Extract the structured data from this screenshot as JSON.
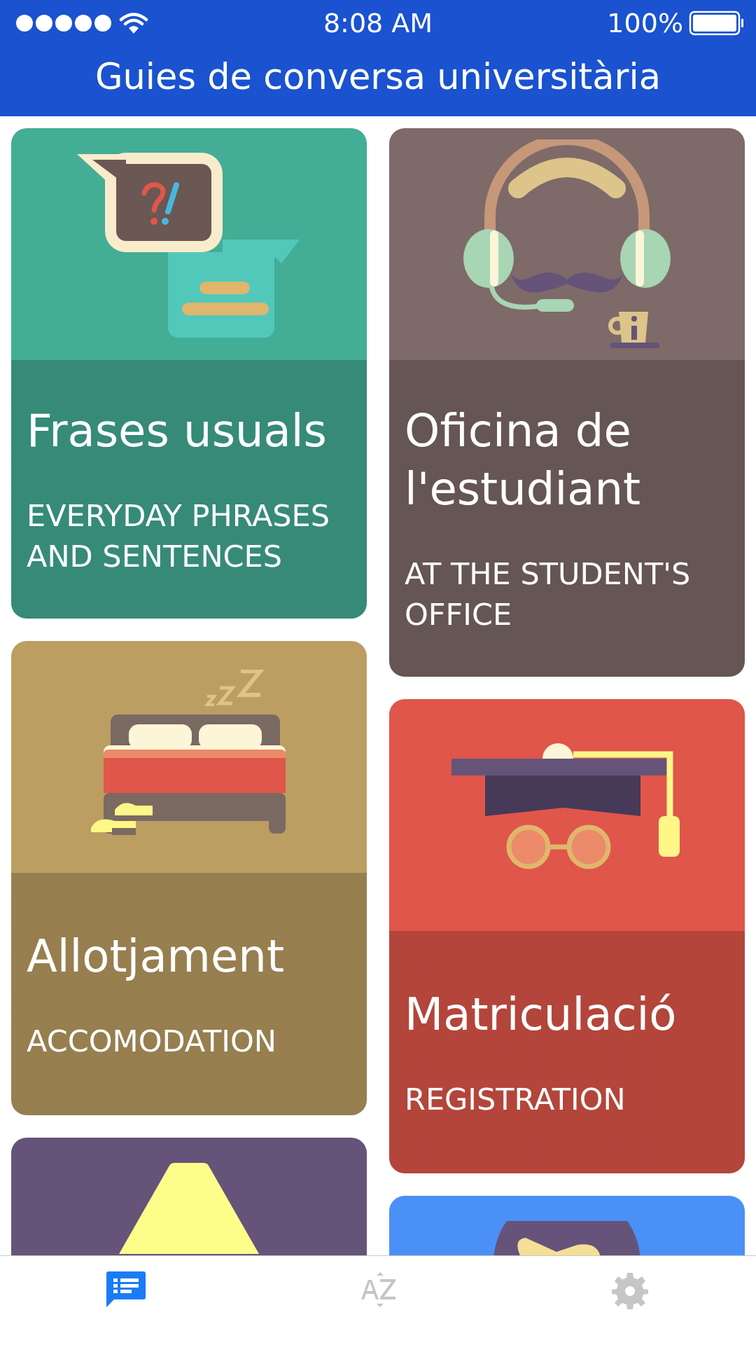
{
  "status_bar": {
    "time": "8:08 AM",
    "battery": "100%"
  },
  "header": {
    "title": "Guies de conversa universitària"
  },
  "columns": [
    [
      {
        "kind": "speech",
        "color": "#44ad96",
        "title": "Frases usuals",
        "subtitle": "EVERYDAY PHRASES AND SENTENCES"
      },
      {
        "kind": "bed",
        "color": "#bc9e63",
        "title": "Allotjament",
        "subtitle": "ACCOMODATION"
      },
      {
        "kind": "lamp",
        "color": "#66537a"
      }
    ],
    [
      {
        "kind": "headset",
        "color": "#7e6a68",
        "title": "Oficina de l'estudiant",
        "subtitle": "AT THE STUDENT'S OFFICE"
      },
      {
        "kind": "cap",
        "color": "#e0564a",
        "title": "Matriculació",
        "subtitle": "REGISTRATION"
      },
      {
        "kind": "globe",
        "color": "#4a90f6"
      }
    ]
  ],
  "tabs": [
    {
      "kind": "phrases",
      "selected": true
    },
    {
      "kind": "az",
      "selected": false
    },
    {
      "kind": "settings",
      "selected": false
    }
  ]
}
